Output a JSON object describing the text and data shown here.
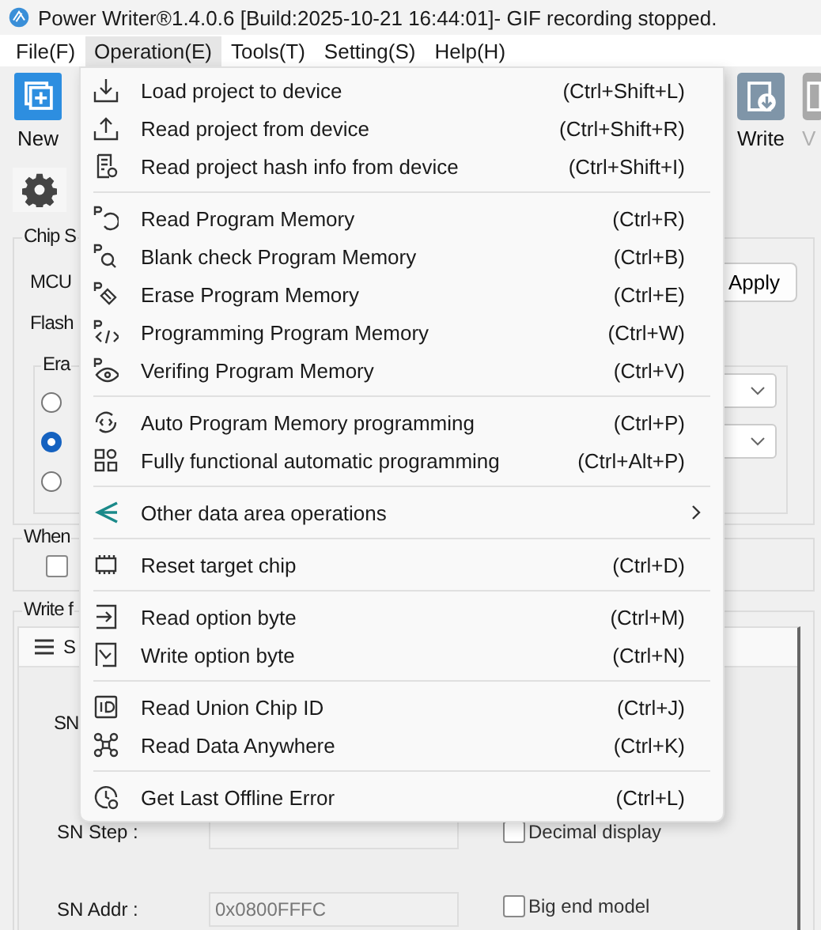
{
  "window": {
    "title": "Power Writer®1.4.0.6 [Build:2025-10-21 16:44:01]- GIF recording stopped."
  },
  "menu_bar": [
    {
      "label": "File(F)",
      "selected": false
    },
    {
      "label": "Operation(E)",
      "selected": true
    },
    {
      "label": "Tools(T)",
      "selected": false
    },
    {
      "label": "Setting(S)",
      "selected": false
    },
    {
      "label": "Help(H)",
      "selected": false
    }
  ],
  "toolbar": [
    {
      "label": "New",
      "disabled": false
    },
    {
      "label": "Write",
      "disabled": false
    },
    {
      "label": "V",
      "disabled": true
    }
  ],
  "operation_menu": [
    [
      {
        "label": "Load  project to device",
        "shortcut": "(Ctrl+Shift+L)",
        "submenu": false
      },
      {
        "label": "Read  project from device",
        "shortcut": "(Ctrl+Shift+R)",
        "submenu": false
      },
      {
        "label": "Read project hash info from device",
        "shortcut": "(Ctrl+Shift+I)",
        "submenu": false
      }
    ],
    [
      {
        "label": "Read Program Memory",
        "shortcut": "(Ctrl+R)",
        "submenu": false
      },
      {
        "label": "Blank check Program Memory",
        "shortcut": "(Ctrl+B)",
        "submenu": false
      },
      {
        "label": "Erase Program Memory",
        "shortcut": "(Ctrl+E)",
        "submenu": false
      },
      {
        "label": "Programming Program Memory",
        "shortcut": "(Ctrl+W)",
        "submenu": false
      },
      {
        "label": "Verifing Program Memory",
        "shortcut": "(Ctrl+V)",
        "submenu": false
      }
    ],
    [
      {
        "label": "Auto Program Memory programming",
        "shortcut": "(Ctrl+P)",
        "submenu": false
      },
      {
        "label": "Fully functional automatic programming",
        "shortcut": "(Ctrl+Alt+P)",
        "submenu": false
      }
    ],
    [
      {
        "label": "Other data area operations",
        "submenu": true
      }
    ],
    [
      {
        "label": "Reset target chip",
        "shortcut": "(Ctrl+D)",
        "submenu": false
      }
    ],
    [
      {
        "label": "Read option byte",
        "shortcut": "(Ctrl+M)",
        "submenu": false
      },
      {
        "label": "Write option byte",
        "shortcut": "(Ctrl+N)",
        "submenu": false
      }
    ],
    [
      {
        "label": "Read Union Chip ID",
        "shortcut": "(Ctrl+J)",
        "submenu": false
      },
      {
        "label": "Read Data Anywhere",
        "shortcut": "(Ctrl+K)",
        "submenu": false
      }
    ],
    [
      {
        "label": "Get Last Offline Error",
        "shortcut": "(Ctrl+L)",
        "submenu": false
      }
    ]
  ],
  "chip_group": {
    "legend": "Chip S",
    "mcu_label": "MCU",
    "flash_label": "Flash",
    "apply_button": "Apply",
    "erase_group": {
      "legend": "Era",
      "radios": [
        {
          "selected": false
        },
        {
          "selected": true
        },
        {
          "selected": false
        }
      ]
    }
  },
  "when_group": {
    "legend": "When",
    "checked": false
  },
  "write_group": {
    "legend": "Write f",
    "tab": "S",
    "fields": [
      {
        "label": "SN"
      },
      {
        "label": "SN Step :",
        "option": "Decimal display",
        "checked": false
      },
      {
        "label": "SN Addr :",
        "value": "0x0800FFFC",
        "option": "Big end model",
        "checked": false
      }
    ]
  }
}
